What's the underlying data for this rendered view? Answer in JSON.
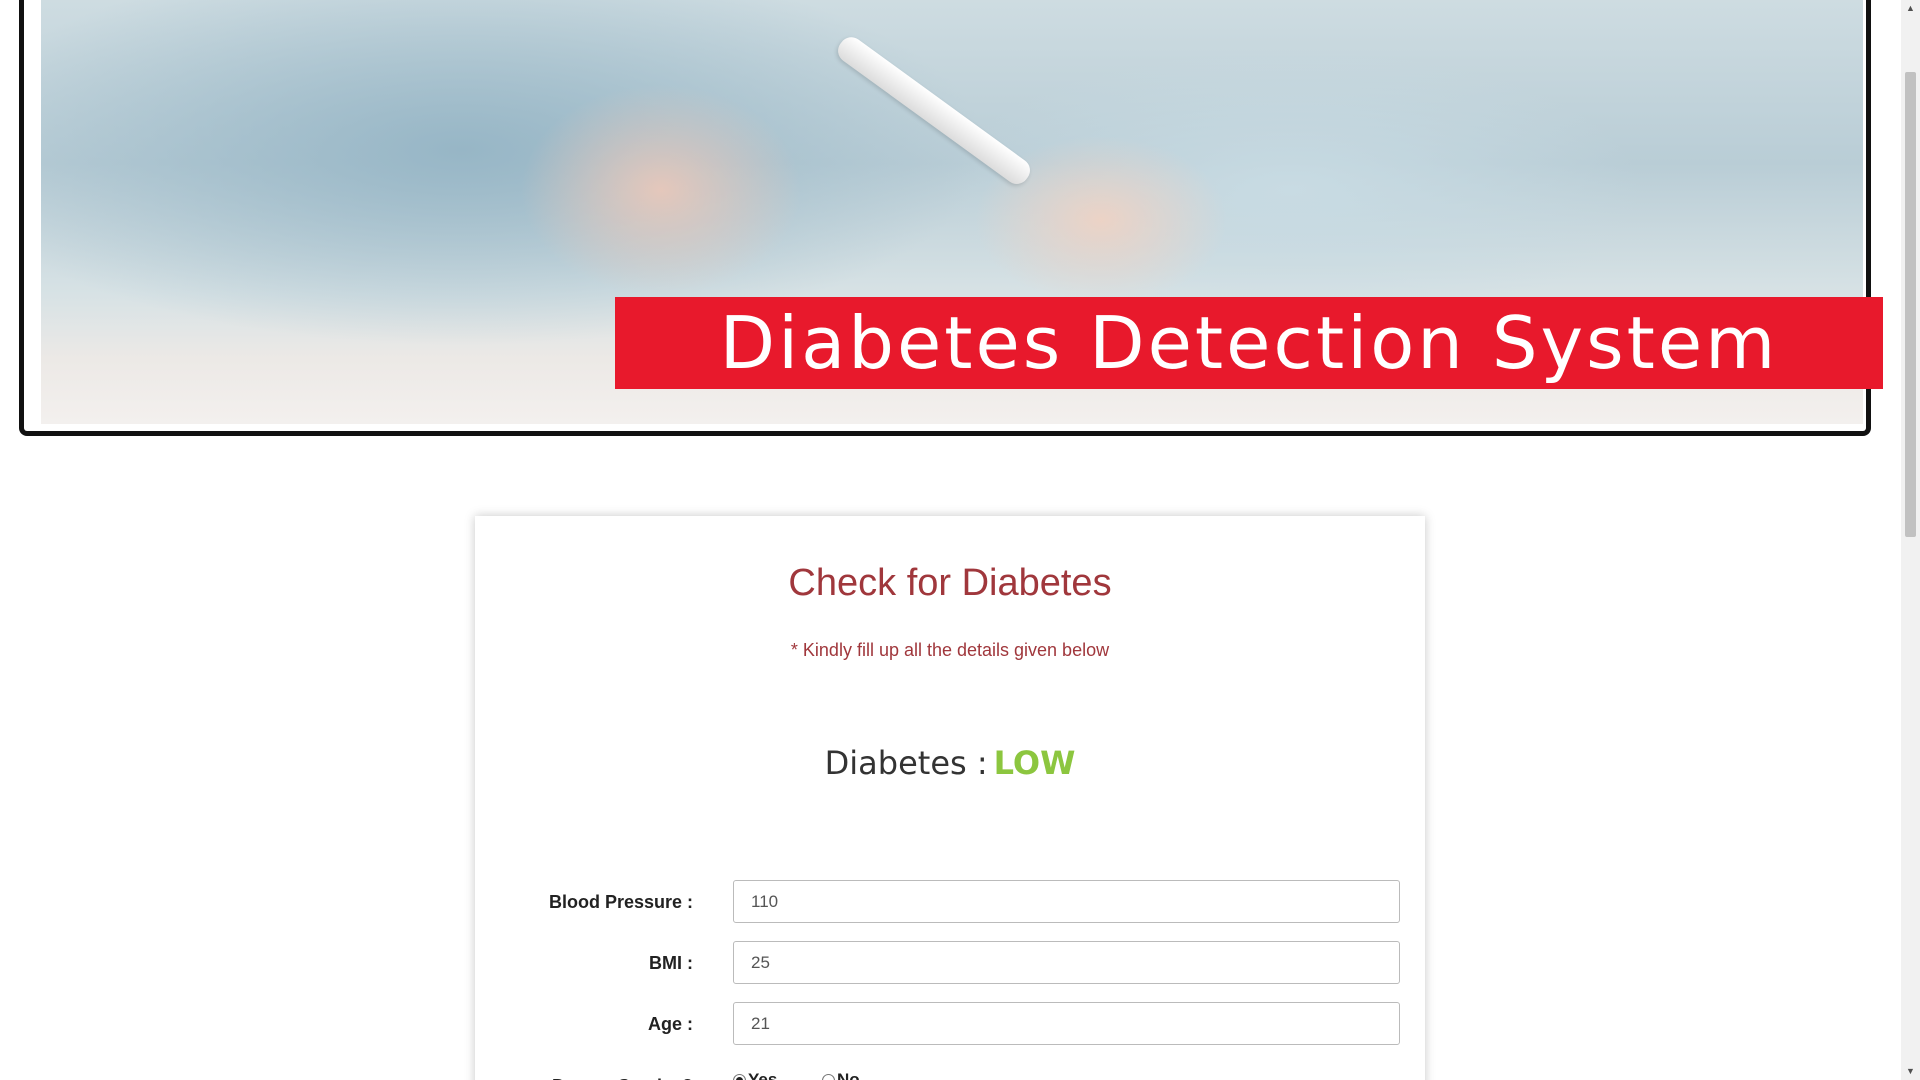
{
  "banner": {
    "title": "Diabetes Detection System",
    "accent_color": "#e8192c"
  },
  "form": {
    "title": "Check for Diabetes",
    "subtitle": "* Kindly fill up all the details given below",
    "result": {
      "label": "Diabetes :",
      "value": "LOW",
      "value_color": "#8cc63f"
    },
    "fields": [
      {
        "label": "Blood Pressure :",
        "value": "110"
      },
      {
        "label": "BMI :",
        "value": "25"
      },
      {
        "label": "Age :",
        "value": "21"
      }
    ],
    "radio_question": "Do you Smoke ?",
    "radio_options": [
      {
        "label": "Yes",
        "checked": true
      },
      {
        "label": "No",
        "checked": false
      }
    ]
  },
  "scrollbar": {
    "up_icon": "scroll-up-arrow-icon",
    "down_icon": "scroll-down-arrow-icon"
  }
}
